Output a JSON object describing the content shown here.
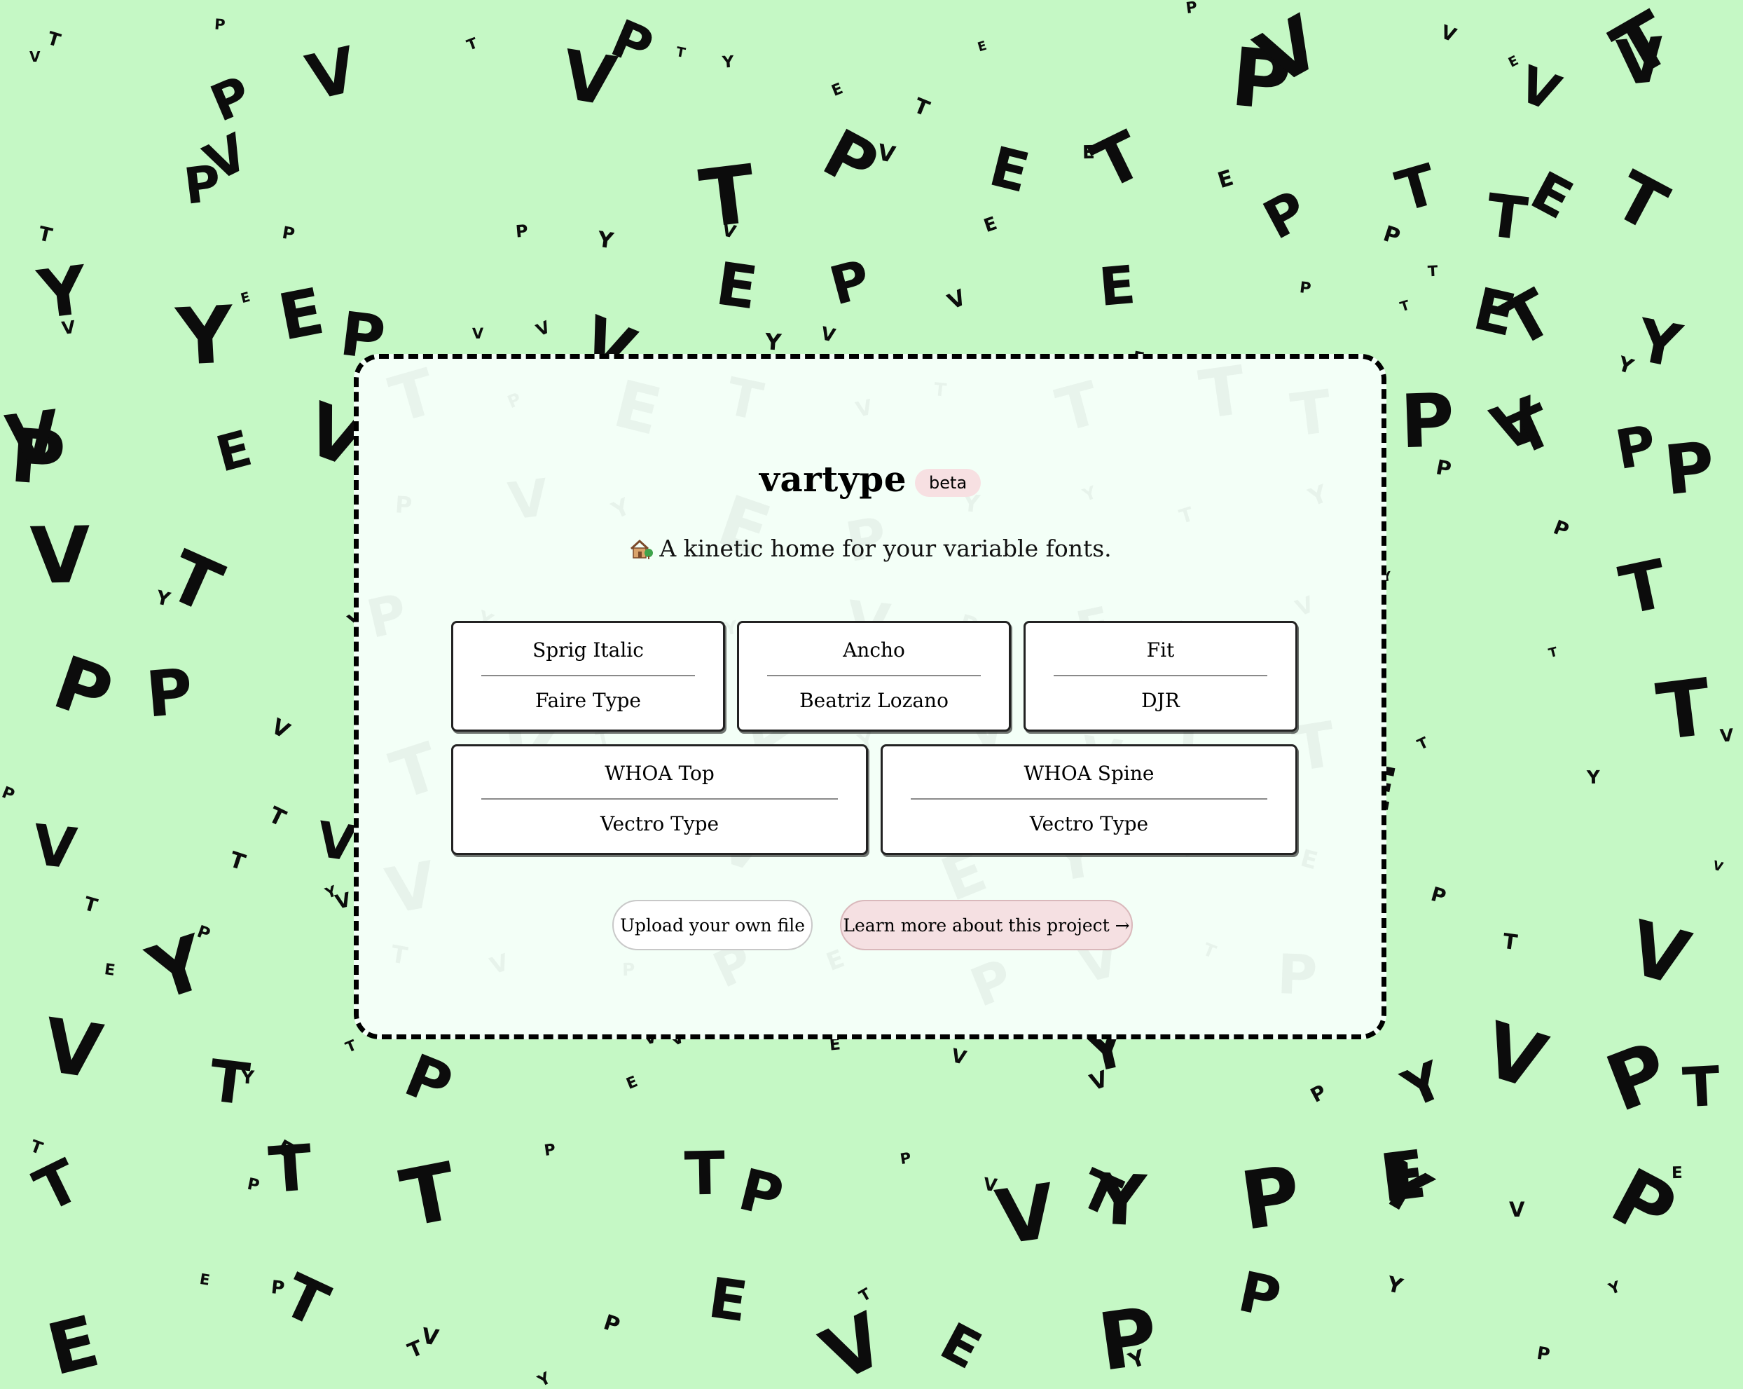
{
  "app": {
    "title": "vartype",
    "badge": "beta",
    "tagline_icon": "house-with-garden-icon",
    "tagline": "A kinetic home for your variable fonts."
  },
  "fonts": [
    {
      "name": "Sprig Italic",
      "foundry": "Faire Type"
    },
    {
      "name": "Ancho",
      "foundry": "Beatriz Lozano"
    },
    {
      "name": "Fit",
      "foundry": "DJR"
    },
    {
      "name": "WHOA Top",
      "foundry": "Vectro Type"
    },
    {
      "name": "WHOA Spine",
      "foundry": "Vectro Type"
    }
  ],
  "actions": {
    "upload_label": "Upload your own file",
    "learn_label": "Learn more about this project →"
  },
  "background": {
    "letters": [
      "V",
      "E",
      "P",
      "T",
      "Y"
    ]
  },
  "colors": {
    "background": "#c5f8c5",
    "card": "#f3fff7",
    "badge": "#f7e0e2",
    "learn_button": "#f5e0e2"
  }
}
